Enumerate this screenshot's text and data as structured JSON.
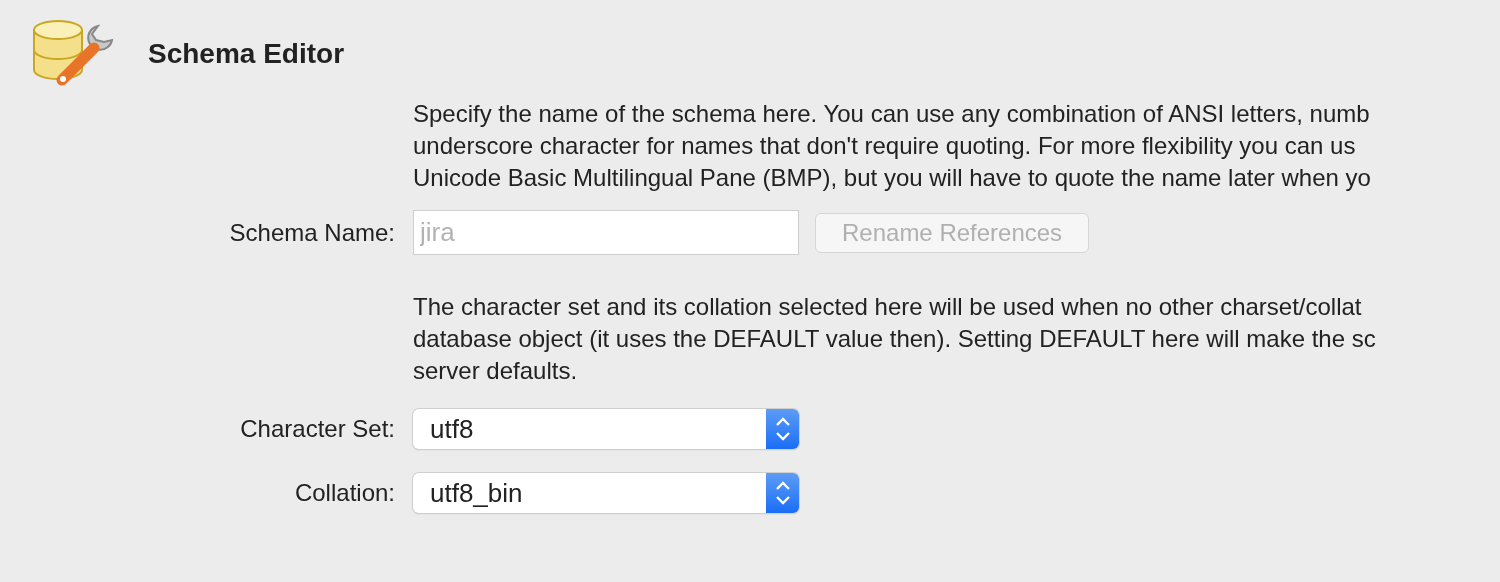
{
  "header": {
    "title": "Schema Editor"
  },
  "name_section": {
    "description_lines": [
      "Specify the name of the schema here. You can use any combination of ANSI letters, numb",
      "underscore character for names that don't require quoting. For more flexibility you can us",
      "Unicode Basic Multilingual Pane (BMP), but you will have to quote the name later when yo"
    ],
    "label": "Schema Name:",
    "field": {
      "value": "jira",
      "disabled": true
    },
    "button": {
      "label": "Rename References",
      "disabled": true
    }
  },
  "charset_section": {
    "description_lines": [
      "The character set and its collation selected here will be used when no other charset/collat",
      "database object (it uses the DEFAULT value then). Setting DEFAULT here will make the sc",
      "server defaults."
    ],
    "selects": [
      {
        "label": "Character Set:",
        "value": "utf8"
      },
      {
        "label": "Collation:",
        "value": "utf8_bin"
      }
    ]
  }
}
